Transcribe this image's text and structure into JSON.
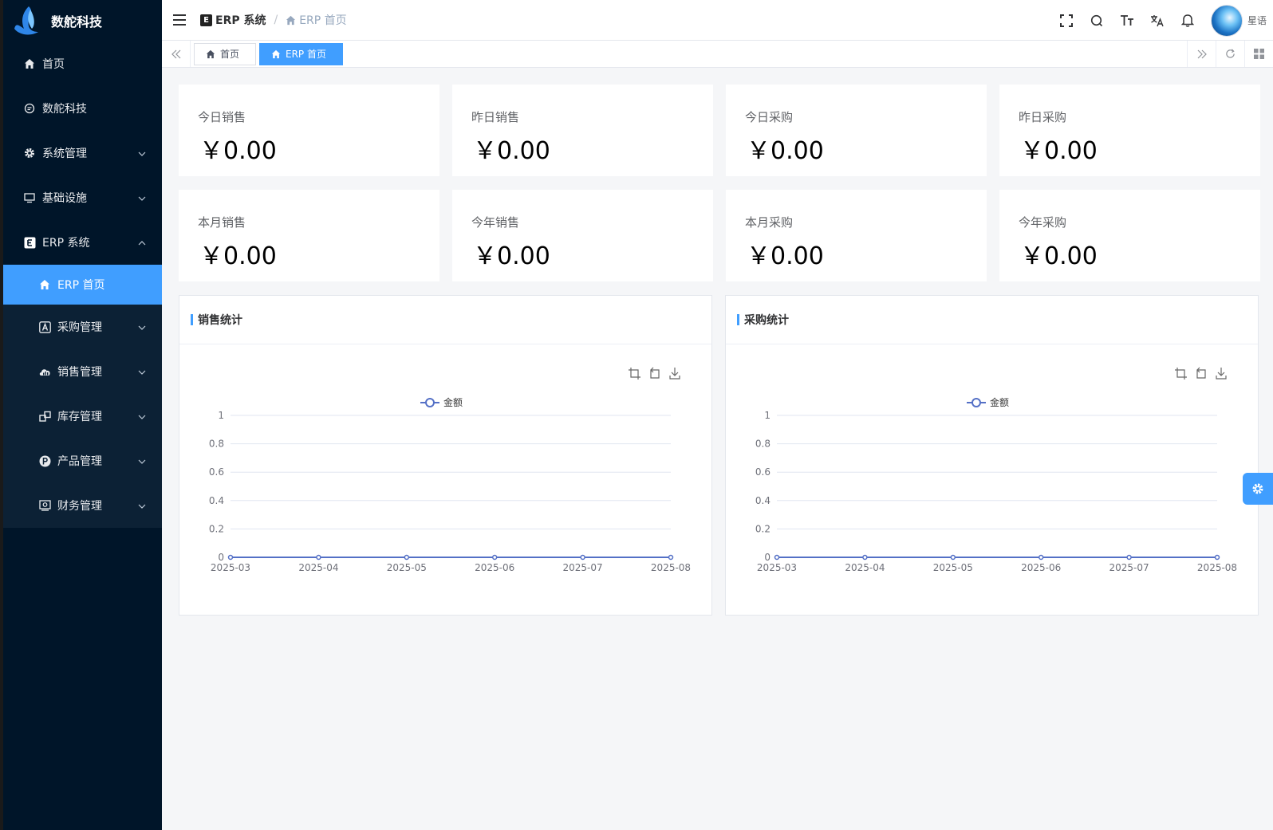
{
  "app": {
    "logo_text": "数舵科技"
  },
  "sidebar": {
    "items": [
      {
        "label": "首页",
        "icon": "home-icon"
      },
      {
        "label": "数舵科技",
        "icon": "chat-icon"
      },
      {
        "label": "系统管理",
        "icon": "gear-icon"
      },
      {
        "label": "基础设施",
        "icon": "monitor-icon"
      },
      {
        "label": "ERP 系统",
        "icon": "erp-icon"
      }
    ],
    "erp_children": [
      {
        "label": "ERP 首页",
        "icon": "home-icon"
      },
      {
        "label": "采购管理",
        "icon": "letter-a-icon"
      },
      {
        "label": "销售管理",
        "icon": "cloud-chart-icon"
      },
      {
        "label": "库存管理",
        "icon": "boxes-icon"
      },
      {
        "label": "产品管理",
        "icon": "letter-p-icon"
      },
      {
        "label": "财务管理",
        "icon": "finance-icon"
      }
    ]
  },
  "header": {
    "breadcrumb": [
      "ERP 系统",
      "ERP 首页"
    ],
    "user": "星语"
  },
  "tags": [
    "首页",
    "ERP 首页"
  ],
  "stats": [
    {
      "label": "今日销售",
      "value": "￥0.00"
    },
    {
      "label": "昨日销售",
      "value": "￥0.00"
    },
    {
      "label": "今日采购",
      "value": "￥0.00"
    },
    {
      "label": "昨日采购",
      "value": "￥0.00"
    },
    {
      "label": "本月销售",
      "value": "￥0.00"
    },
    {
      "label": "今年销售",
      "value": "￥0.00"
    },
    {
      "label": "本月采购",
      "value": "￥0.00"
    },
    {
      "label": "今年采购",
      "value": "￥0.00"
    }
  ],
  "panels": [
    {
      "title": "销售统计"
    },
    {
      "title": "采购统计"
    }
  ],
  "colors": {
    "primary": "#409eff",
    "sidebar_bg": "#001529",
    "series": "#5470c6"
  },
  "chart_data": [
    {
      "type": "line",
      "title": "",
      "x": [
        "2025-03",
        "2025-04",
        "2025-05",
        "2025-06",
        "2025-07",
        "2025-08"
      ],
      "series": [
        {
          "name": "金额",
          "values": [
            0,
            0,
            0,
            0,
            0,
            0
          ]
        }
      ],
      "yticks": [
        "0",
        "0.2",
        "0.4",
        "0.6",
        "0.8",
        "1"
      ],
      "ylim": [
        0,
        1
      ],
      "grid": true,
      "legend": "top-center"
    },
    {
      "type": "line",
      "title": "",
      "x": [
        "2025-03",
        "2025-04",
        "2025-05",
        "2025-06",
        "2025-07",
        "2025-08"
      ],
      "series": [
        {
          "name": "金额",
          "values": [
            0,
            0,
            0,
            0,
            0,
            0
          ]
        }
      ],
      "yticks": [
        "0",
        "0.2",
        "0.4",
        "0.6",
        "0.8",
        "1"
      ],
      "ylim": [
        0,
        1
      ],
      "grid": true,
      "legend": "top-center"
    }
  ]
}
